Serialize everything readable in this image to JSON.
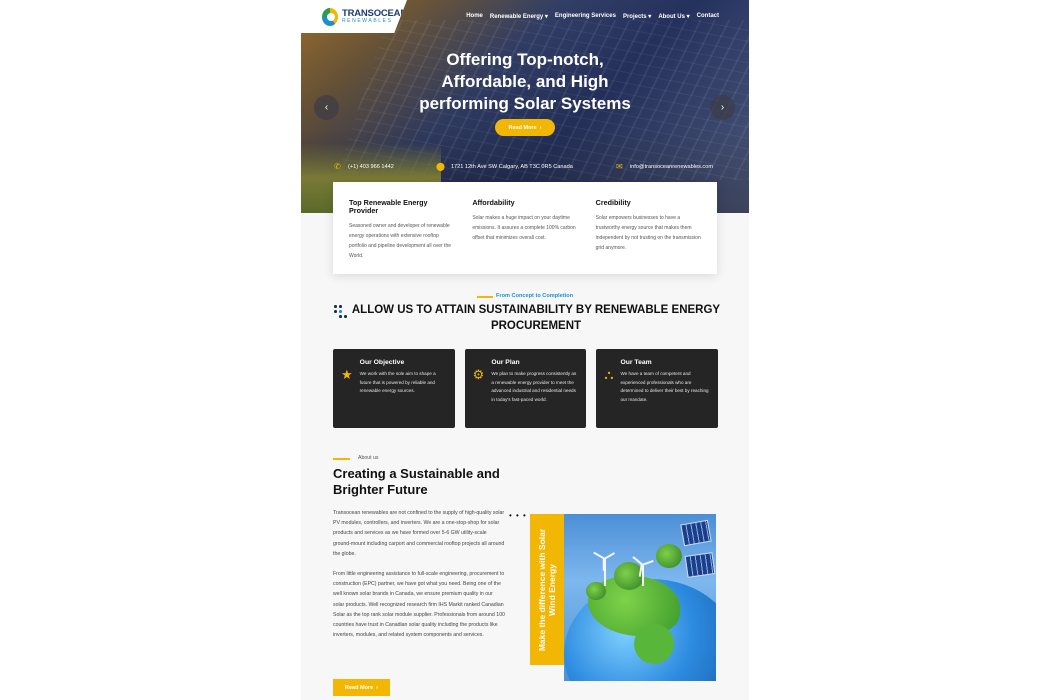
{
  "brand": {
    "name": "TRANSOCEAN",
    "sub": "RENEWABLES",
    "colors": {
      "accent": "#f2b705",
      "blue": "#1d8fd0",
      "dark": "#252525"
    }
  },
  "nav": {
    "items": [
      "Home",
      "Renewable Energy ▾",
      "Engineering Services",
      "Projects ▾",
      "About Us ▾",
      "Contact"
    ]
  },
  "hero": {
    "title_line1": "Offering Top-notch,",
    "title_line2": "Affordable, and High",
    "title_line3": "performing Solar Systems",
    "button_label": "Read More",
    "button_icon": "chevron-right-icon",
    "prev_icon": "chevron-left-icon",
    "next_icon": "chevron-right-icon"
  },
  "contact": {
    "phone": "(+1) 403 966 1442",
    "address": "1721 12th Ave SW Calgary, AB T3C 0R5 Canada",
    "email": "info@transoceanrenewables.com"
  },
  "features": [
    {
      "title": "Top Renewable Energy Provider",
      "text": "Seasoned owner and developer of renewable energy operations with extensive rooftop portfolio and pipeline development all over the World."
    },
    {
      "title": "Affordability",
      "text": "Solar makes a huge impact on your daytime emissions. It assures a complete 100% carbon offset that minimizes overall cost."
    },
    {
      "title": "Credibility",
      "text": "Solar empowers businesses to have a trustworthy energy source that makes them independent by not trusting on the transmission grid anymore."
    }
  ],
  "section2": {
    "kicker": "From Concept to Completion",
    "title_line1": "ALLOW US TO ATTAIN SUSTAINABILITY BY RENEWABLE ENERGY",
    "title_line2": "PROCUREMENT",
    "cards": [
      {
        "icon": "star-icon",
        "title": "Our Objective",
        "text": "We work with the sole aim to shape a future that is powered by reliable and renewable energy sources."
      },
      {
        "icon": "gear-icon",
        "title": "Our Plan",
        "text": "We plan to make progress consistently as a renewable energy provider to meet the advanced industrial and residential needs in today's fast-paced world."
      },
      {
        "icon": "team-icon",
        "title": "Our Team",
        "text": "We have a team of competent and experienced professionals who are determined to deliver their best by reaching our mandate."
      }
    ]
  },
  "about": {
    "kicker": "About us",
    "title_line1": "Creating a Sustainable and",
    "title_line2": "Brighter Future",
    "p1": "Transocean renewables are not confined to the supply of high-quality solar PV modules, controllers, and inverters. We are a one-stop-shop for solar products and services as we have formed over 5-6 GW utility-scale ground-mount including carport and commercial rooftop projects all around the globe.",
    "p2": "From little engineering assistance to full-scale engineering, procurement to construction (EPC) partner, we have got what you need. Being one of the well known solar brands in Canada, we ensure premium quality in our solar products. Well recognized research firm IHS Markit ranked Canadian Solar as the top rank solar module supplier. Professionals from around 100 countries have trust in Canadian solar quality including the products like inverters, modules, and related system components and services.",
    "button_label": "Read More",
    "banner_line1": "Make the difference with Solar",
    "banner_line2": "Wind Energy"
  }
}
